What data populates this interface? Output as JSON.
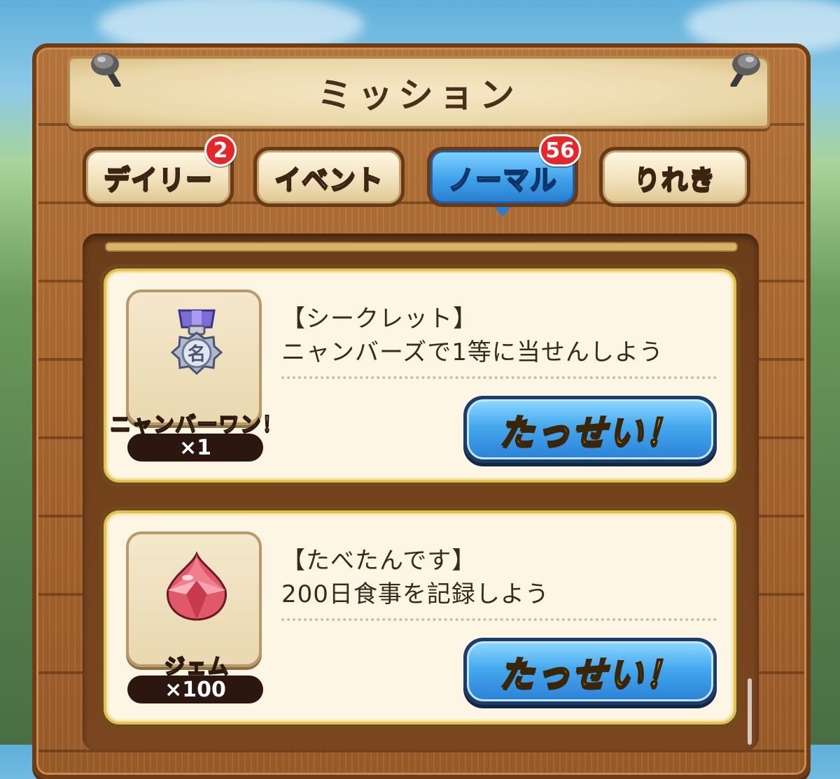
{
  "header": {
    "title": "ミッション"
  },
  "tabs": [
    {
      "label": "デイリー",
      "badge": "2",
      "active": false
    },
    {
      "label": "イベント",
      "badge": "",
      "active": false
    },
    {
      "label": "ノーマル",
      "badge": "56",
      "active": true
    },
    {
      "label": "りれき",
      "badge": "",
      "active": false
    }
  ],
  "missions": [
    {
      "category": "【シークレット】",
      "description": "ニャンバーズで1等に当せんしよう",
      "reward_name": "ニャンバーワン！",
      "reward_qty": "×1",
      "reward_icon": "medal-icon",
      "button_label": "たっせい！"
    },
    {
      "category": "【たべたんです】",
      "description": "200日食事を記録しよう",
      "reward_name": "ジェム",
      "reward_qty": "×100",
      "reward_icon": "gem-icon",
      "button_label": "たっせい！"
    }
  ],
  "colors": {
    "wood": "#a9672f",
    "active_tab": "#3fa2ea",
    "badge": "#e8262a",
    "button_text": "#ffd63a"
  }
}
